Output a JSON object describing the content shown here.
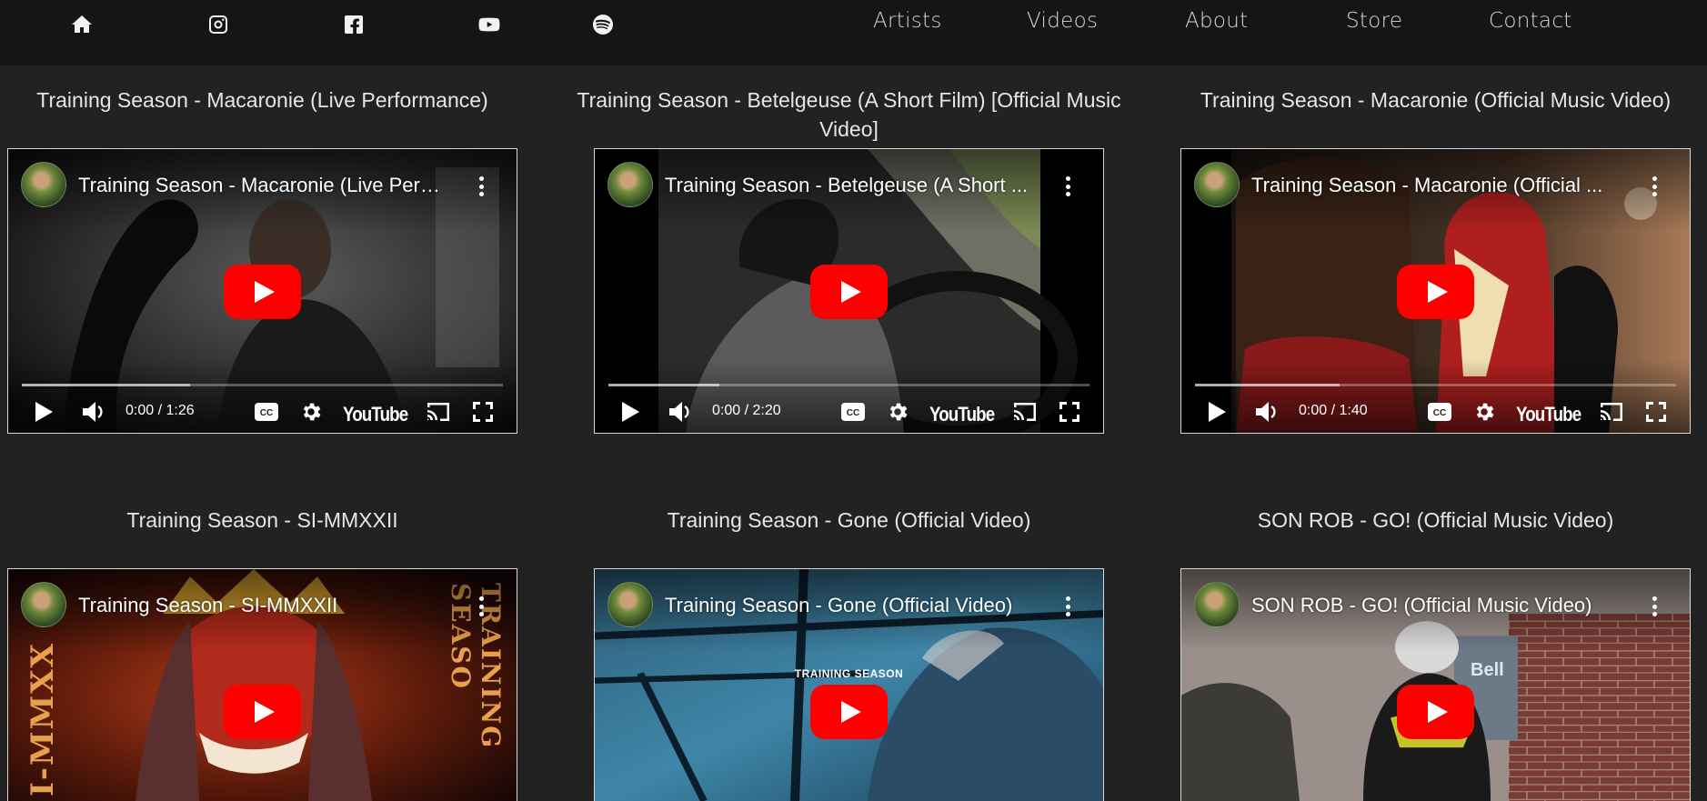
{
  "social_icons": [
    "home-icon",
    "instagram-icon",
    "facebook-icon",
    "youtube-icon",
    "spotify-icon"
  ],
  "nav": {
    "items": [
      "Artists",
      "Videos",
      "About",
      "Store",
      "Contact"
    ]
  },
  "videos": [
    {
      "heading": "Training Season - Macaronie (Live Performance)",
      "player_title": "Training Season - Macaronie (Live Perf...",
      "time": "0:00 / 1:26",
      "progress_buffered": 0.35
    },
    {
      "heading": "Training Season - Betelgeuse (A Short Film) [Official Music Video]",
      "player_title": "Training Season - Betelgeuse (A Short ...",
      "time": "0:00 / 2:20",
      "progress_buffered": 0.23
    },
    {
      "heading": "Training Season - Macaronie (Official Music Video)",
      "player_title": "Training Season - Macaronie (Official ...",
      "time": "0:00 / 1:40",
      "progress_buffered": 0.3
    },
    {
      "heading": "Training Season - SI-MMXXII",
      "player_title": "Training Season - SI-MMXXII"
    },
    {
      "heading": "Training Season - Gone (Official Video)",
      "player_title": "Training Season - Gone (Official Video)",
      "thumb_caption": "TRAINING SEASON"
    },
    {
      "heading": "SON ROB - GO! (Official Music Video)",
      "player_title": "SON ROB - GO! (Official Music Video)",
      "thumb_sign": "Bell"
    }
  ],
  "youtube_logo": "YouTube",
  "colors": {
    "page_bg": "#222222",
    "topbar_bg": "#151515",
    "play_button": "#ff0000"
  }
}
